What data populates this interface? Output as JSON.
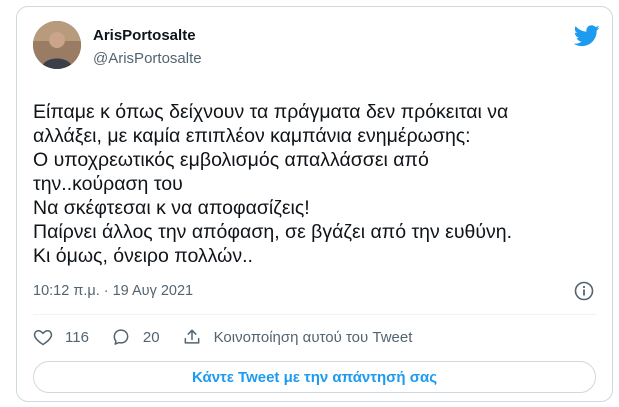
{
  "colors": {
    "accent": "#1d9bf0",
    "muted": "#536471",
    "text": "#0f1419",
    "border": "#cfd9de"
  },
  "author": {
    "name": "ArisPortosalte",
    "handle": "@ArisPortosalte"
  },
  "tweet": {
    "text": "Είπαμε κ όπως δείχνουν τα πράγματα δεν πρόκειται να\nαλλάξει, με καμία επιπλέον καμπάνια ενημέρωσης:\nΟ υποχρεωτικός εμβολισμός απαλλάσσει από\nτην..κούραση του\nΝα σκέφτεσαι κ να αποφασίζεις!\nΠαίρνει άλλος την απόφαση, σε βγάζει από την ευθύνη.\nΚι όμως, όνειρο πολλών..",
    "timestamp": "10:12 π.μ. · 19 Αυγ 2021"
  },
  "actions": {
    "likes": "116",
    "replies": "20",
    "share_label": "Κοινοποίηση αυτού του Tweet"
  },
  "reply_button_label": "Κάντε Tweet με την απάντησή σας",
  "icons": [
    "twitter-bird-icon",
    "info-icon",
    "heart-icon",
    "reply-icon",
    "share-icon"
  ]
}
